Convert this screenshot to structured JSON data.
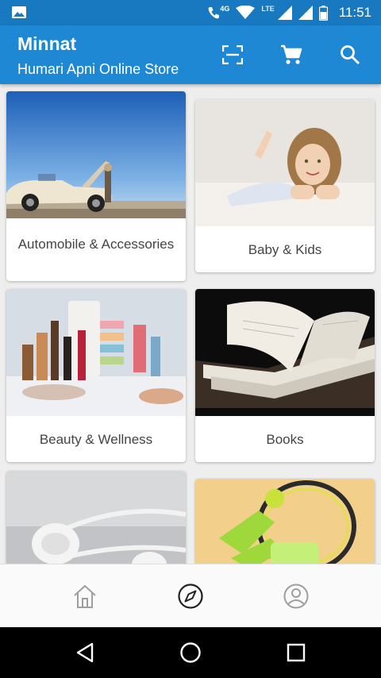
{
  "status_bar": {
    "time": "11:51",
    "network_4g": "4G",
    "network_lte": "LTE",
    "icons": [
      "image-notification-icon",
      "wifi-calling-icon",
      "wifi-icon",
      "signal-icon",
      "signal-icon",
      "battery-icon"
    ]
  },
  "app_bar": {
    "title": "Minnat",
    "subtitle": "Humari Apni Online Store",
    "icons": [
      "scan-icon",
      "cart-icon",
      "search-icon"
    ]
  },
  "categories": [
    {
      "label": "Automobile & Accessories"
    },
    {
      "label": "Baby & Kids"
    },
    {
      "label": "Beauty & Wellness"
    },
    {
      "label": "Books"
    },
    {
      "label": ""
    },
    {
      "label": ""
    }
  ],
  "bottom_nav": {
    "items": [
      "home-icon",
      "explore-icon",
      "profile-icon"
    ],
    "active": "explore-icon"
  },
  "system_nav": [
    "back-icon",
    "home-circle-icon",
    "recents-icon"
  ],
  "colors": {
    "status_bar": "#1979c0",
    "app_bar": "#1e88d4",
    "background": "#eeeeee",
    "label_text": "#444444"
  }
}
